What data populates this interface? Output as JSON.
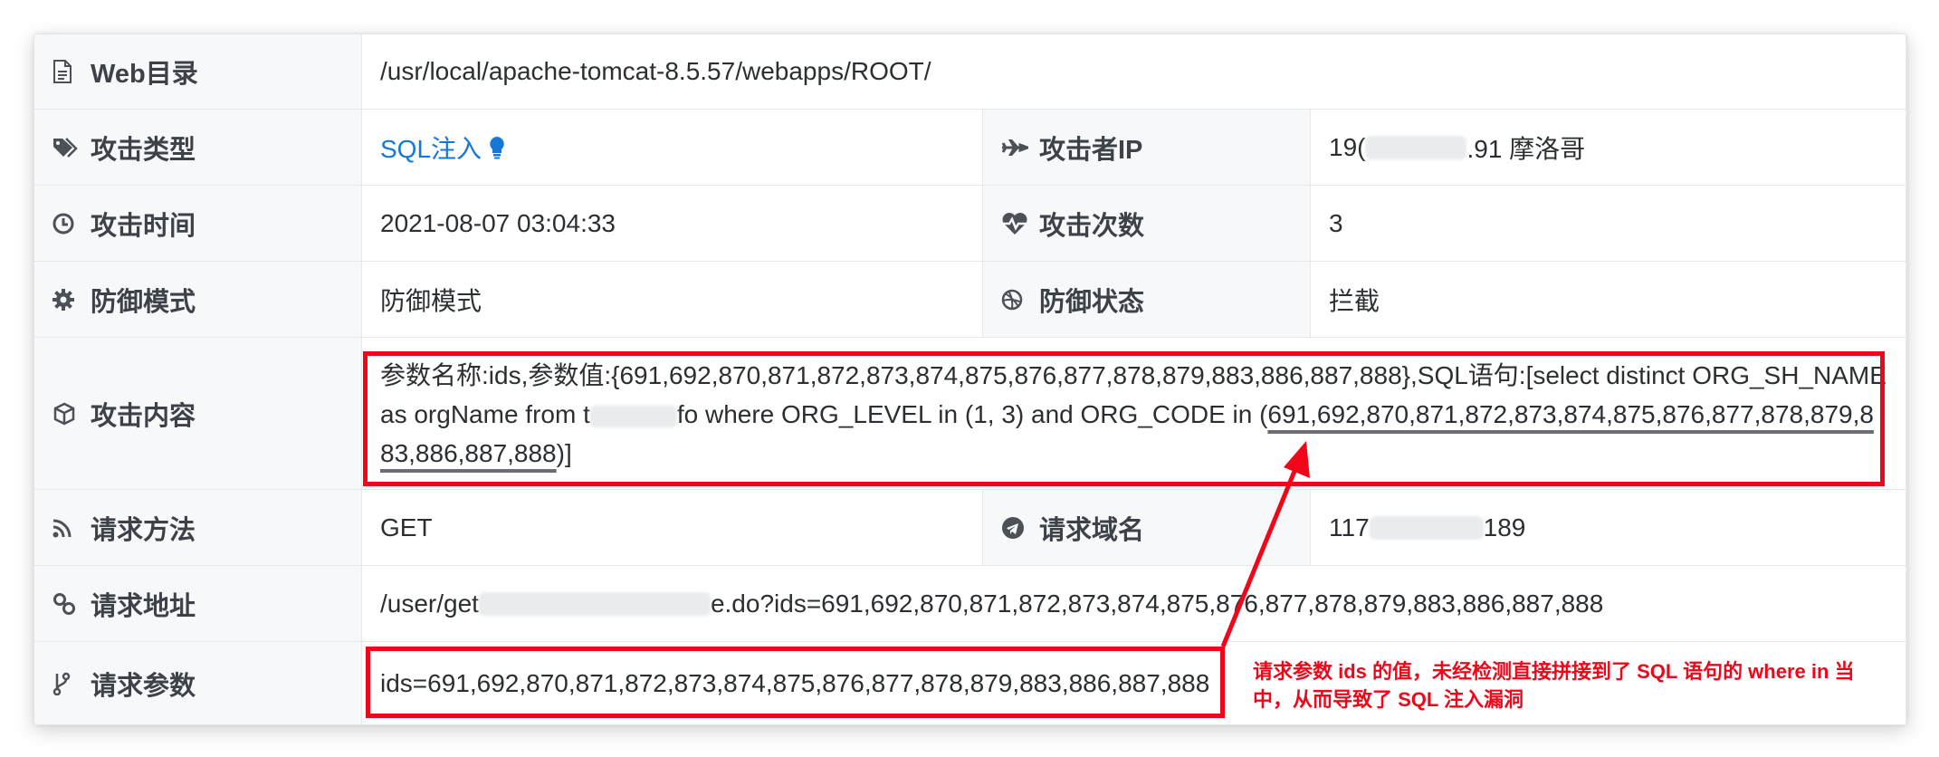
{
  "rows": {
    "web_dir": {
      "label": "Web目录",
      "icon": "document-icon",
      "value": "/usr/local/apache-tomcat-8.5.57/webapps/ROOT/"
    },
    "attack_type": {
      "label": "攻击类型",
      "icon": "tags-icon",
      "value": "SQL注入"
    },
    "attacker_ip": {
      "label": "攻击者IP",
      "icon": "plane-icon",
      "value_prefix": "19(",
      "value_suffix": ".91 摩洛哥"
    },
    "attack_time": {
      "label": "攻击时间",
      "icon": "clock-icon",
      "value": "2021-08-07 03:04:33"
    },
    "attack_count": {
      "label": "攻击次数",
      "icon": "heartbeat-icon",
      "value": "3"
    },
    "defense_mode": {
      "label": "防御模式",
      "icon": "gear-icon",
      "value": "防御模式"
    },
    "defense_status": {
      "label": "防御状态",
      "icon": "dribbble-icon",
      "value": "拦截"
    },
    "attack_content": {
      "label": "攻击内容",
      "icon": "cube-icon",
      "part1": "参数名称:ids,参数值:{691,692,870,871,872,873,874,875,876,877,878,879,883,886,887,888},SQL语句:[select distinct ORG_SH_NAME as orgName from t",
      "part2": "fo where ORG_LEVEL in (1, 3) and ORG_CODE in (",
      "underlined": "691,692,870,871,872,873,874,875,876,877,878,879,883,886,887,888",
      "part3": ")]"
    },
    "request_method": {
      "label": "请求方法",
      "icon": "rss-icon",
      "value": "GET"
    },
    "request_domain": {
      "label": "请求域名",
      "icon": "telegram-icon",
      "value_prefix": "117",
      "value_suffix": "189"
    },
    "request_url": {
      "label": "请求地址",
      "icon": "link-icon",
      "value_prefix": "/user/get",
      "value_suffix": "e.do?ids=691,692,870,871,872,873,874,875,876,877,878,879,883,886,887,888"
    },
    "request_params": {
      "label": "请求参数",
      "icon": "branch-icon",
      "value": "ids=691,692,870,871,872,873,874,875,876,877,878,879,883,886,887,888"
    }
  },
  "annotation": {
    "text": "请求参数 ids 的值，未经检测直接拼接到了 SQL 语句的 where in 当中，从而导致了 SQL 注入漏洞",
    "color": "#f00519"
  }
}
